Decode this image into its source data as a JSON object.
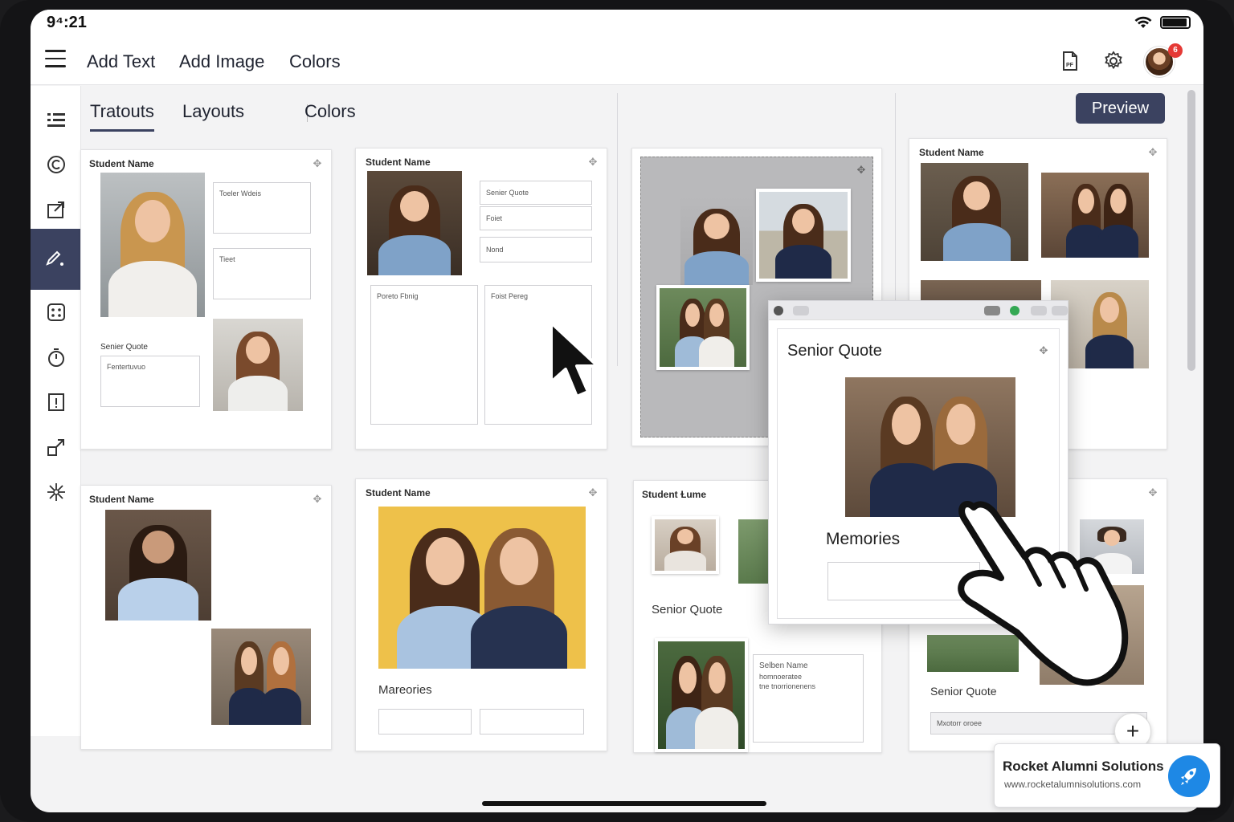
{
  "status": {
    "time": "9⁴:21"
  },
  "topbar": {
    "menu": [
      "Add Text",
      "Add Image",
      "Colors"
    ],
    "notification_count": "6",
    "icons": [
      "pdf-export-icon",
      "settings-gear-icon",
      "user-avatar"
    ]
  },
  "sidebar": {
    "items": [
      "list-icon",
      "copyright-icon",
      "export-icon",
      "magic-edit-icon",
      "grid-dots-icon",
      "timer-icon",
      "info-book-icon",
      "resize-icon",
      "sparkle-icon"
    ],
    "active_index": 3
  },
  "tabs": {
    "items": [
      "Tratouts",
      "Layouts",
      "Colors"
    ],
    "active": "Tratouts"
  },
  "preview_label": "Preview",
  "cards": {
    "c1": {
      "title": "Student Name",
      "box1": "Toeler Wdeis",
      "box2": "Tieet",
      "quote_label": "Senier Quote",
      "box3": "Fentertuvuo"
    },
    "c2": {
      "title": "Student Name",
      "f1": "Senier Quote",
      "f2": "Foiet",
      "f3": "Nond",
      "f4": "Poreto Fbnig",
      "f5": "Foist Pereg"
    },
    "c4": {
      "title": "Student Name"
    },
    "c5": {
      "title": "Student Name"
    },
    "c6": {
      "title": "Student Name",
      "memories": "Mareories"
    },
    "c7": {
      "title": "Student Ɫume",
      "quote": "Senior Quote",
      "text1": "Selben Name",
      "text2": "homnoeratee",
      "text3": "tne tnorrionenens"
    },
    "c8": {
      "quote": "Senior Quote",
      "box": "Mxotorr oroee"
    }
  },
  "overlay": {
    "title": "Senior Quote",
    "memories": "Memories"
  },
  "watermark": {
    "title": "Rocket Alumni Solutions",
    "url": "www.rocketalumnisolutions.com"
  },
  "colors": {
    "accent": "#3b4260",
    "badge": "#e53935",
    "logo": "#1e88e5",
    "yellow_bg": "#eec14a",
    "navy_top": "#1f2a48",
    "denim": "#7fa2c8"
  }
}
